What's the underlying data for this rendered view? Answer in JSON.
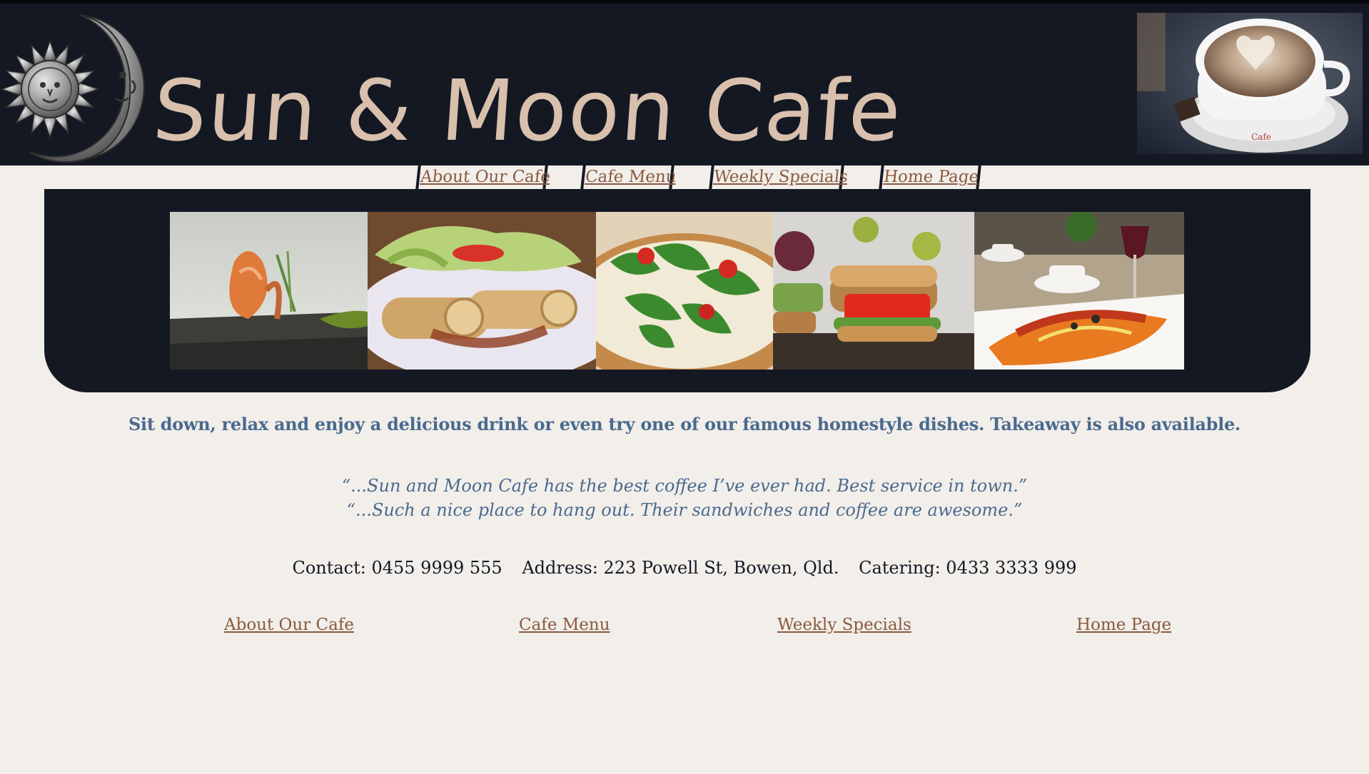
{
  "header": {
    "title": "Sun & Moon Cafe",
    "logo_icon": "sun-moon-logo-icon",
    "photo_icon": "latte-cup-photo"
  },
  "nav": {
    "items": [
      {
        "label": "About Our Cafe"
      },
      {
        "label": "Cafe Menu"
      },
      {
        "label": "Weekly Specials"
      },
      {
        "label": "Home Page"
      }
    ]
  },
  "banner": {
    "photos": [
      "prawn-dish-photo",
      "wraps-salad-photo",
      "rocket-pizza-photo",
      "open-sandwich-photo",
      "cafe-table-dish-photo"
    ]
  },
  "tagline": "Sit down, relax and enjoy a delicious drink or even try one of our famous homestyle dishes. Takeaway is also available.",
  "testimonials": [
    "“...Sun and Moon Cafe has the best coffee I’ve ever had. Best service in town.”",
    "“...Such a nice place to hang out. Their sandwiches and coffee are awesome.”"
  ],
  "contact": {
    "phone": "Contact: 0455 9999 555",
    "address": "Address: 223 Powell St, Bowen, Qld.",
    "catering": "Catering: 0433 3333 999"
  },
  "footer_nav": {
    "items": [
      {
        "label": "About Our Cafe"
      },
      {
        "label": "Cafe Menu"
      },
      {
        "label": "Weekly Specials"
      },
      {
        "label": "Home Page"
      }
    ]
  },
  "colors": {
    "header_bg": "#141823",
    "title": "#d8c0ad",
    "link": "#8a5a3f",
    "body_text": "#4a6a8e",
    "page_bg": "#f2eeea"
  }
}
